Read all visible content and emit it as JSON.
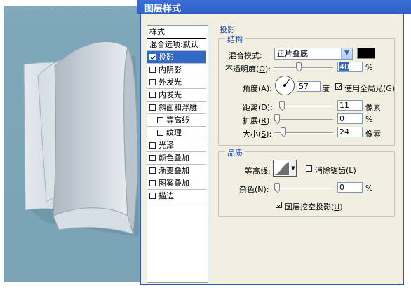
{
  "window": {
    "title": "图层样式"
  },
  "styles_list": {
    "header": "样式",
    "blend_default": "混合选项:默认",
    "items": [
      {
        "label": "投影",
        "checked": true,
        "selected": true,
        "indent": false
      },
      {
        "label": "内阴影",
        "checked": false,
        "selected": false,
        "indent": false
      },
      {
        "label": "外发光",
        "checked": false,
        "selected": false,
        "indent": false
      },
      {
        "label": "内发光",
        "checked": false,
        "selected": false,
        "indent": false
      },
      {
        "label": "斜面和浮雕",
        "checked": false,
        "selected": false,
        "indent": false
      },
      {
        "label": "等高线",
        "checked": false,
        "selected": false,
        "indent": true
      },
      {
        "label": "纹理",
        "checked": false,
        "selected": false,
        "indent": true
      },
      {
        "label": "光泽",
        "checked": false,
        "selected": false,
        "indent": false
      },
      {
        "label": "颜色叠加",
        "checked": false,
        "selected": false,
        "indent": false
      },
      {
        "label": "渐变叠加",
        "checked": false,
        "selected": false,
        "indent": false
      },
      {
        "label": "图案叠加",
        "checked": false,
        "selected": false,
        "indent": false
      },
      {
        "label": "描边",
        "checked": false,
        "selected": false,
        "indent": false
      }
    ]
  },
  "drop_shadow": {
    "section_title": "投影",
    "structure": {
      "title": "结构",
      "blend_mode_label": "混合模式:",
      "blend_mode_value": "正片叠底",
      "shadow_color": "#000000",
      "opacity_label": "不透明度(",
      "opacity_key": "O",
      "opacity_value": "40",
      "angle_label": "角度(",
      "angle_key": "A",
      "angle_value": "57",
      "angle_unit": "度",
      "global_light_label": "使用全局光(",
      "global_light_key": "G",
      "global_light_checked": true,
      "distance_label": "距离(",
      "distance_key": "D",
      "distance_value": "11",
      "spread_label": "扩展(",
      "spread_key": "R",
      "spread_value": "0",
      "size_label": "大小(",
      "size_key": "S",
      "size_value": "24",
      "unit_pixels": "像素",
      "unit_percent": "%",
      "label_close": "):"
    },
    "quality": {
      "title": "品质",
      "contour_label": "等高线:",
      "antialias_label": "消除锯齿(",
      "antialias_key": "L",
      "antialias_checked": false,
      "noise_label": "杂色(",
      "noise_key": "N",
      "noise_value": "0",
      "knockout_label": "图层挖空投影(",
      "knockout_key": "U",
      "knockout_checked": true
    }
  },
  "colors": {
    "accent": "#316ac5",
    "group_title": "#1d4bc0",
    "title_bar": "#2e5fc5"
  }
}
